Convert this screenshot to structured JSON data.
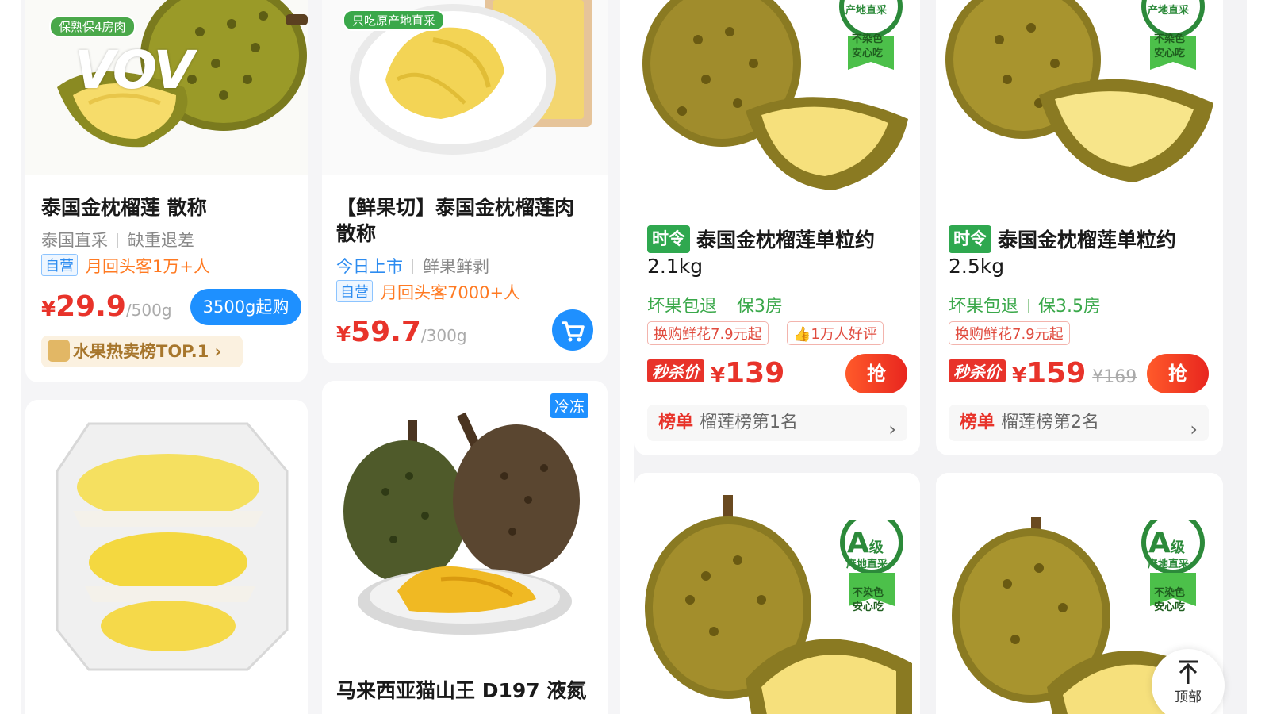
{
  "colors": {
    "price_red": "#e8332a",
    "accent_blue": "#1e90ff",
    "green": "#3aa84a",
    "orange": "#ff7a22"
  },
  "watermark": "VOV",
  "products": {
    "p1": {
      "image_tag": "保熟保4房肉",
      "title": "泰国金枕榴莲 散称",
      "sub_a": "泰国直采",
      "sub_b": "缺重退差",
      "self_tag": "自营",
      "repeat": "月回头客1万+人",
      "currency": "¥",
      "price": "29.9",
      "unit": "/500g",
      "min_buy": "3500g起购",
      "rank_chip": "水果热卖榜TOP.1 ›"
    },
    "p2": {
      "image_tag": "只吃原产地直采",
      "title": "【鲜果切】泰国金枕榴莲肉散称",
      "sub_a": "今日上市",
      "sub_b": "鲜果鲜剥",
      "self_tag": "自营",
      "repeat": "月回头客7000+人",
      "currency": "¥",
      "price": "59.7",
      "unit": "/300g",
      "cart_icon": "shopping-cart-icon"
    },
    "p3": {
      "badge_frozen": "冷冻",
      "title": "马来西亚猫山王 D197 液氮"
    },
    "p5": {
      "season_badge": "时令",
      "title_line1": "泰国金枕榴莲单粒约",
      "title_line2": "2.1kg",
      "sub_a": "坏果包退",
      "sub_b": "保3房",
      "promo_a": "换购鲜花7.9元起",
      "promo_b": "1万人好评",
      "flash_tag": "秒杀价",
      "currency": "¥",
      "price": "139",
      "grab": "抢",
      "rank_label": "榜单",
      "rank_text": "榴莲榜第1名"
    },
    "p6": {
      "season_badge": "时令",
      "title_line1": "泰国金枕榴莲单粒约",
      "title_line2": "2.5kg",
      "sub_a": "坏果包退",
      "sub_b": "保3.5房",
      "promo_a": "换购鲜花7.9元起",
      "flash_tag": "秒杀价",
      "currency": "¥",
      "price": "159",
      "original": "¥169",
      "grab": "抢",
      "rank_label": "榜单",
      "rank_text": "榴莲榜第2名"
    }
  },
  "grade_badge": {
    "grade": "A",
    "grade_suffix": "级",
    "line1": "产地直采",
    "line2": "不染色",
    "line3": "安心吃"
  },
  "to_top": {
    "label": "顶部"
  }
}
